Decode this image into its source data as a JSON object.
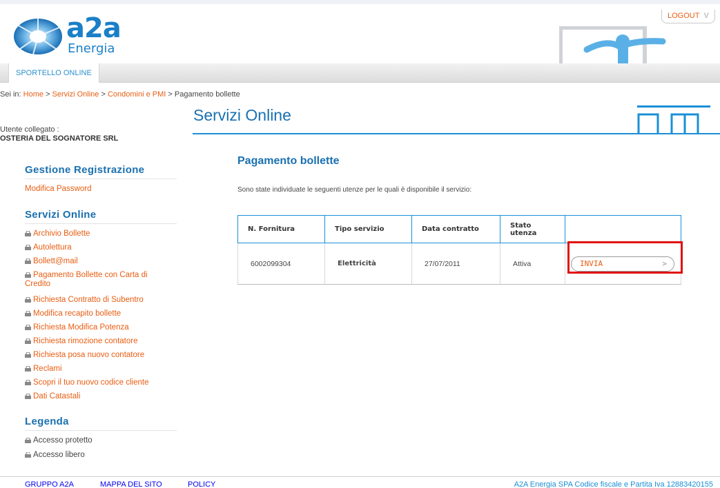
{
  "header": {
    "logo_brand": "a2a",
    "logo_sub": "Energia",
    "logout_label": "LOGOUT",
    "logout_chevron": "V"
  },
  "nav": {
    "tab_label": "SPORTELLO ONLINE"
  },
  "breadcrumb": {
    "prefix": "Sei in:",
    "items": [
      "Home",
      "Servizi Online",
      "Condomini e PMI",
      "Pagamento bollette"
    ],
    "separator": ">"
  },
  "sidebar": {
    "user_label": "Utente collegato :",
    "user_name": "OSTERIA DEL SOGNATORE SRL",
    "registration_title": "Gestione Registrazione",
    "registration_links": [
      "Modifica Password"
    ],
    "services_title": "Servizi Online",
    "services_links": [
      "Archivio Bollette",
      "Autolettura",
      "Bollett@mail",
      "Pagamento Bollette con Carta di",
      "Credito",
      "Richiesta Contratto di Subentro",
      "Modifica recapito bollette",
      "Richiesta Modifica Potenza",
      "Richiesta rimozione contatore",
      "Richiesta posa nuovo contatore",
      "Reclami",
      "Scopri il tuo nuovo codice cliente",
      "Dati Catastali"
    ],
    "legend_title": "Legenda",
    "legend_items": [
      "Accesso protetto",
      "Accesso libero"
    ]
  },
  "main": {
    "title": "Servizi Online",
    "content_title": "Pagamento bollette",
    "intro": "Sono state individuate le seguenti utenze per le quali è disponibile il servizio:",
    "table": {
      "headers": [
        "N. Fornitura",
        "Tipo servizio",
        "Data contratto",
        "Stato utenza",
        ""
      ],
      "rows": [
        [
          "6002099304",
          "Elettricità",
          "27/07/2011",
          "Attiva"
        ]
      ],
      "button_label": "INVIA",
      "button_chevron": ">"
    }
  },
  "footer": {
    "links": [
      "GRUPPO A2A",
      "MAPPA DEL SITO",
      "POLICY"
    ],
    "legal": "A2A Energia SPA Codice fiscale e Partita Iva 12883420155"
  },
  "colors": {
    "brand_blue": "#1a70b0",
    "accent_orange": "#e85d12",
    "highlight_red": "#e01010"
  }
}
